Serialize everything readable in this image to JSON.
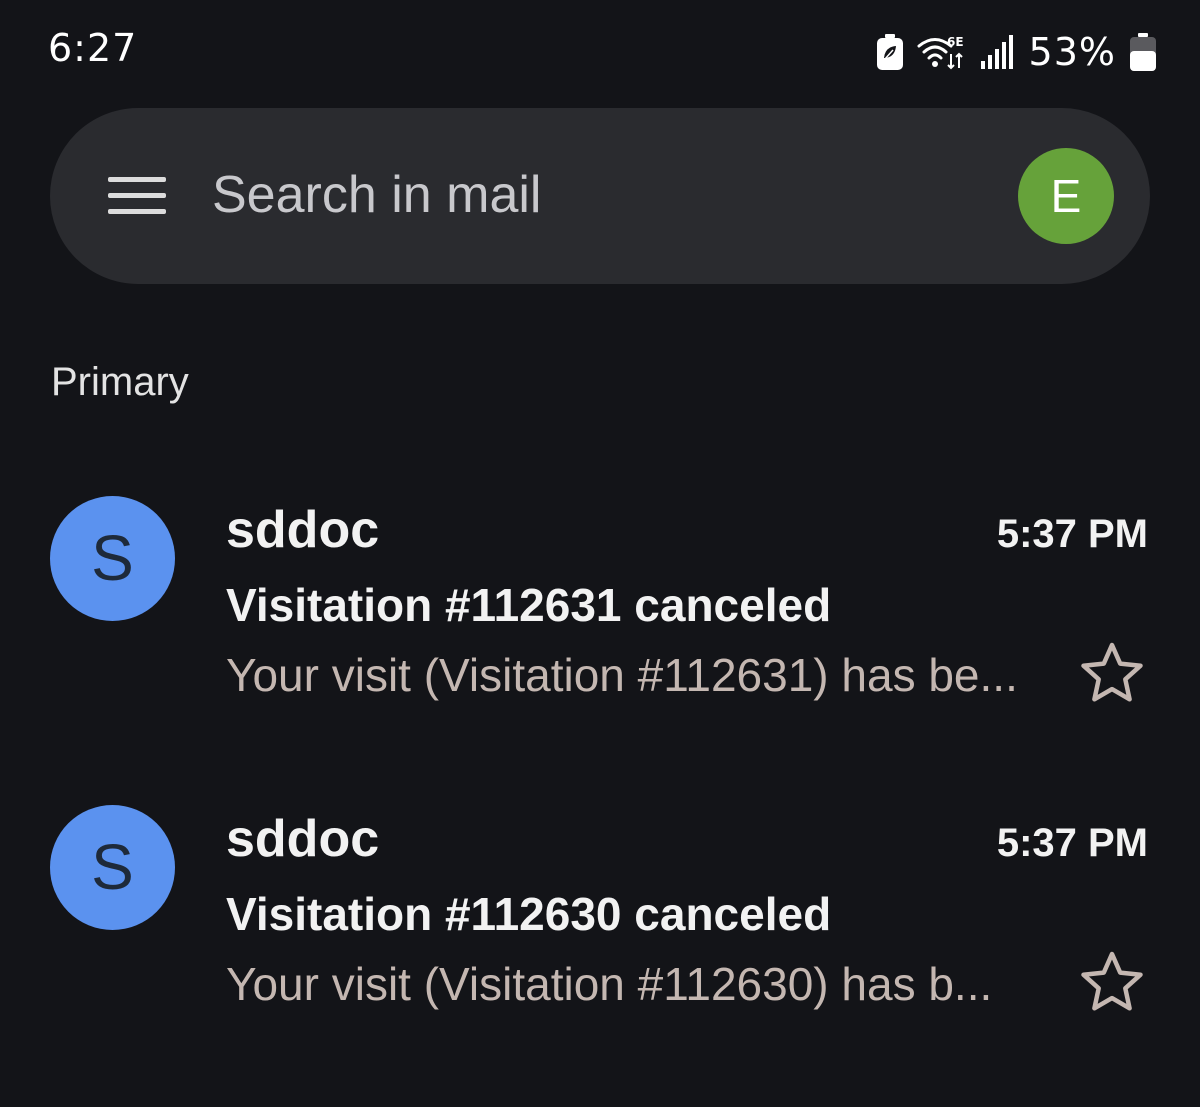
{
  "status_bar": {
    "time": "6:27",
    "battery_percent": "53%",
    "icons": [
      "battery-saver-icon",
      "wifi-6e-icon",
      "signal-icon",
      "battery-icon"
    ]
  },
  "search": {
    "placeholder": "Search in mail",
    "menu_icon": "menu-icon",
    "account_initial": "E",
    "account_color": "#66a23a"
  },
  "section": {
    "label": "Primary"
  },
  "emails": [
    {
      "avatar_initial": "S",
      "avatar_color": "#5b92ef",
      "sender": "sddoc",
      "time": "5:37 PM",
      "subject": "Visitation #112631 canceled",
      "snippet": "Your visit (Visitation #112631) has be...",
      "starred": false
    },
    {
      "avatar_initial": "S",
      "avatar_color": "#5b92ef",
      "sender": "sddoc",
      "time": "5:37 PM",
      "subject": "Visitation #112630 canceled",
      "snippet": "Your visit (Visitation #112630) has b...",
      "starred": false
    }
  ],
  "colors": {
    "background": "#131418",
    "search_bar": "#2a2b2f",
    "snippet_text": "#c4b7b1"
  }
}
